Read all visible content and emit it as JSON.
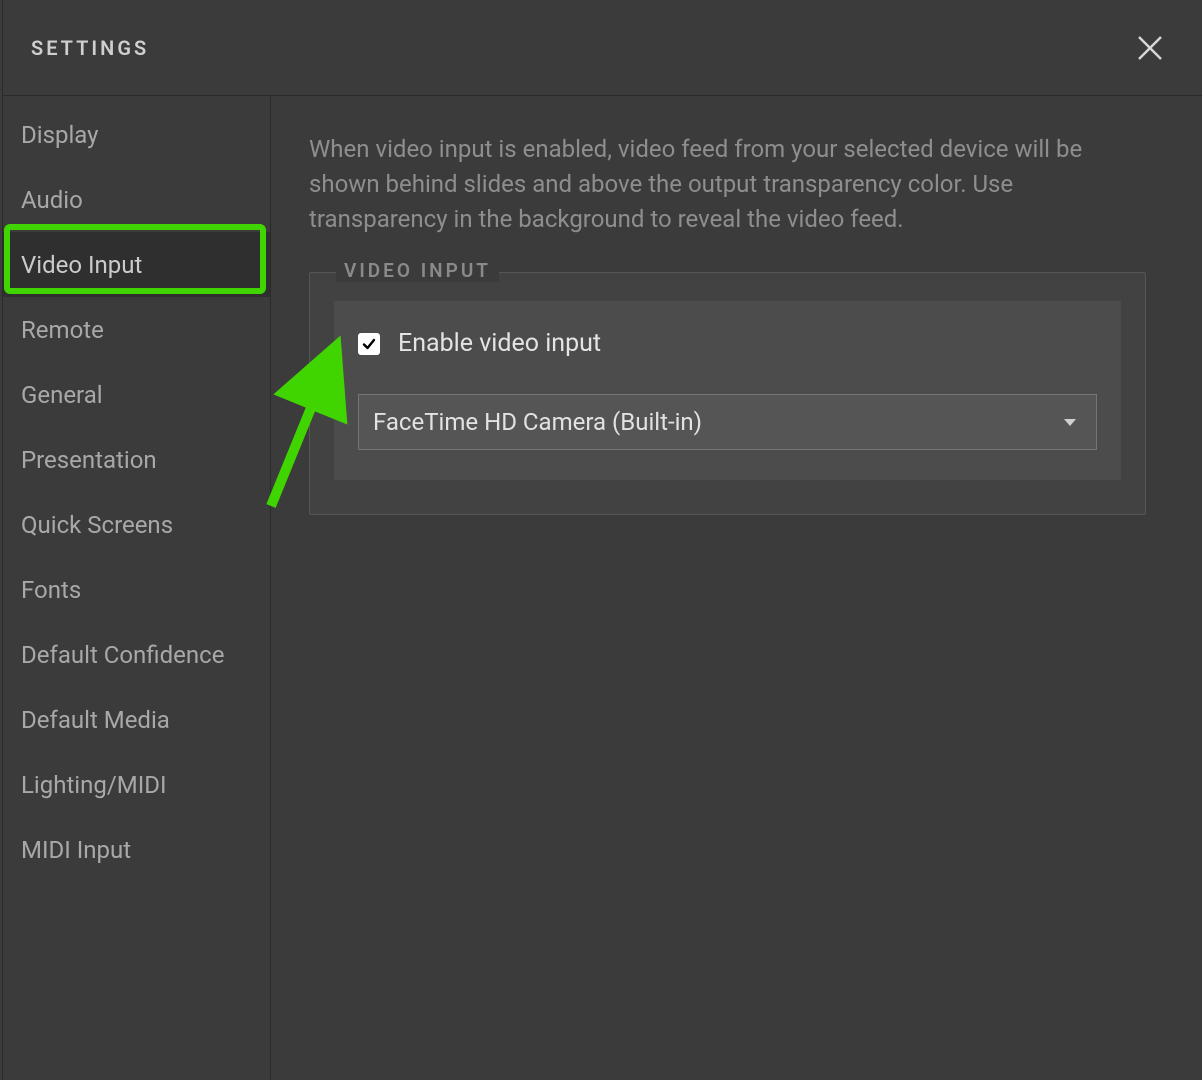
{
  "header": {
    "title": "SETTINGS"
  },
  "sidebar": {
    "items": [
      {
        "label": "Display",
        "selected": false
      },
      {
        "label": "Audio",
        "selected": false
      },
      {
        "label": "Video Input",
        "selected": true
      },
      {
        "label": "Remote",
        "selected": false
      },
      {
        "label": "General",
        "selected": false
      },
      {
        "label": "Presentation",
        "selected": false
      },
      {
        "label": "Quick Screens",
        "selected": false
      },
      {
        "label": "Fonts",
        "selected": false
      },
      {
        "label": "Default Confidence",
        "selected": false
      },
      {
        "label": "Default Media",
        "selected": false
      },
      {
        "label": "Lighting/MIDI",
        "selected": false
      },
      {
        "label": "MIDI Input",
        "selected": false
      }
    ]
  },
  "content": {
    "description": "When video input is enabled, video feed from your selected device will be shown behind slides and above the output transparency color. Use transparency in the background to reveal the video feed.",
    "fieldset_legend": "VIDEO INPUT",
    "enable_checkbox": {
      "checked": true,
      "label": "Enable video input"
    },
    "device_select": {
      "value": "FaceTime HD Camera (Built-in)"
    }
  },
  "annotation": {
    "highlight_color": "#40d400"
  }
}
